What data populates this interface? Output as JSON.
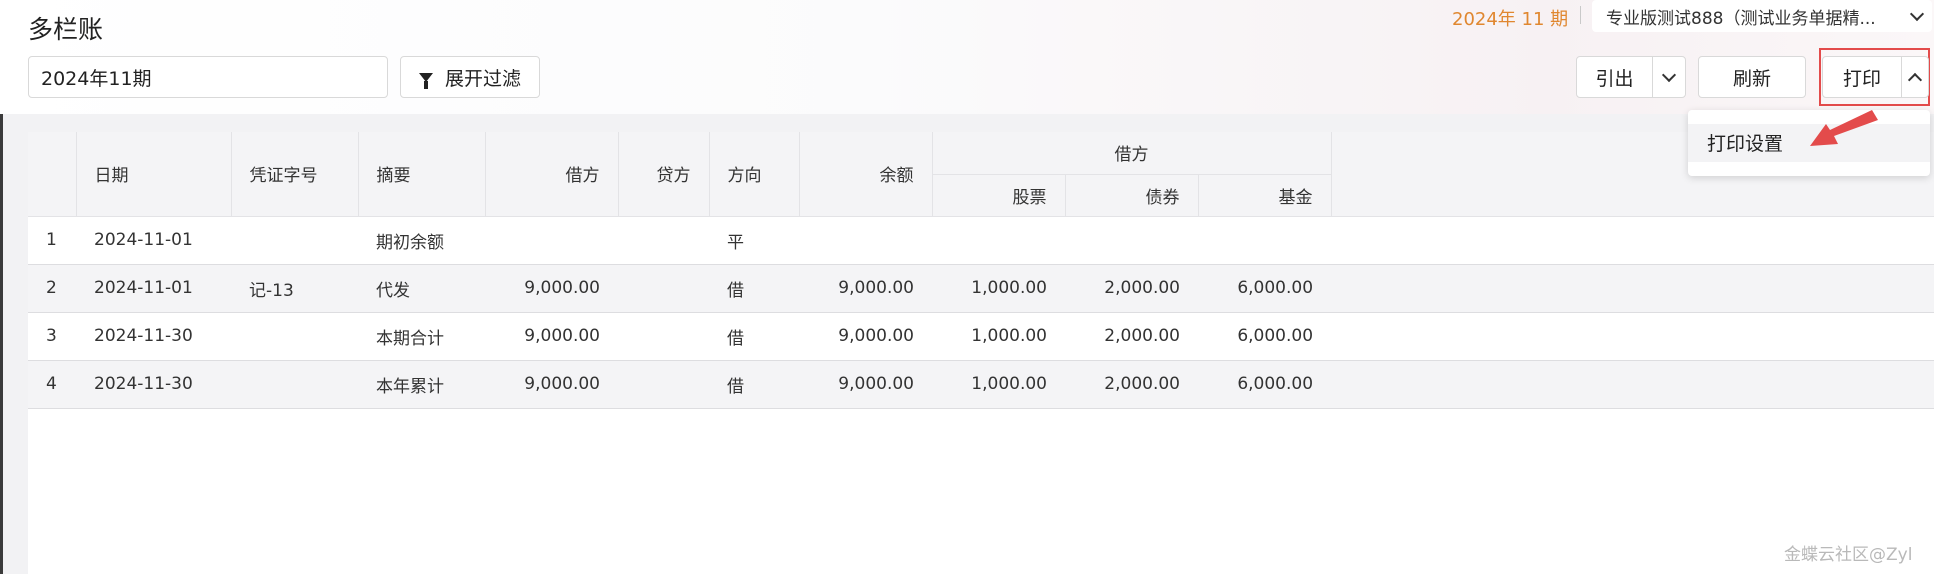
{
  "header": {
    "title": "多栏账",
    "period": "2024年 11 期",
    "org": "专业版测试888（测试业务单据精..."
  },
  "toolbar": {
    "period_value": "2024年11期",
    "filter_label": "展开过滤",
    "export_label": "引出",
    "refresh_label": "刷新",
    "print_label": "打印"
  },
  "dropdown": {
    "print_settings": "打印设置"
  },
  "table": {
    "headers": {
      "date": "日期",
      "voucher": "凭证字号",
      "summary": "摘要",
      "debit": "借方",
      "credit": "贷方",
      "direction": "方向",
      "balance": "余额",
      "group": "借方",
      "sub1": "股票",
      "sub2": "债券",
      "sub3": "基金"
    },
    "rows": [
      {
        "no": "1",
        "date": "2024-11-01",
        "voucher": "",
        "summary": "期初余额",
        "debit": "",
        "credit": "",
        "direction": "平",
        "balance": "",
        "s1": "",
        "s2": "",
        "s3": ""
      },
      {
        "no": "2",
        "date": "2024-11-01",
        "voucher": "记-13",
        "summary": "代发",
        "debit": "9,000.00",
        "credit": "",
        "direction": "借",
        "balance": "9,000.00",
        "s1": "1,000.00",
        "s2": "2,000.00",
        "s3": "6,000.00"
      },
      {
        "no": "3",
        "date": "2024-11-30",
        "voucher": "",
        "summary": "本期合计",
        "debit": "9,000.00",
        "credit": "",
        "direction": "借",
        "balance": "9,000.00",
        "s1": "1,000.00",
        "s2": "2,000.00",
        "s3": "6,000.00"
      },
      {
        "no": "4",
        "date": "2024-11-30",
        "voucher": "",
        "summary": "本年累计",
        "debit": "9,000.00",
        "credit": "",
        "direction": "借",
        "balance": "9,000.00",
        "s1": "1,000.00",
        "s2": "2,000.00",
        "s3": "6,000.00"
      }
    ]
  },
  "watermark": "金蝶云社区@Zyl",
  "colors": {
    "accent_orange": "#e0872f",
    "link_blue": "#3d7fd6",
    "highlight_red": "#e34b4b"
  }
}
